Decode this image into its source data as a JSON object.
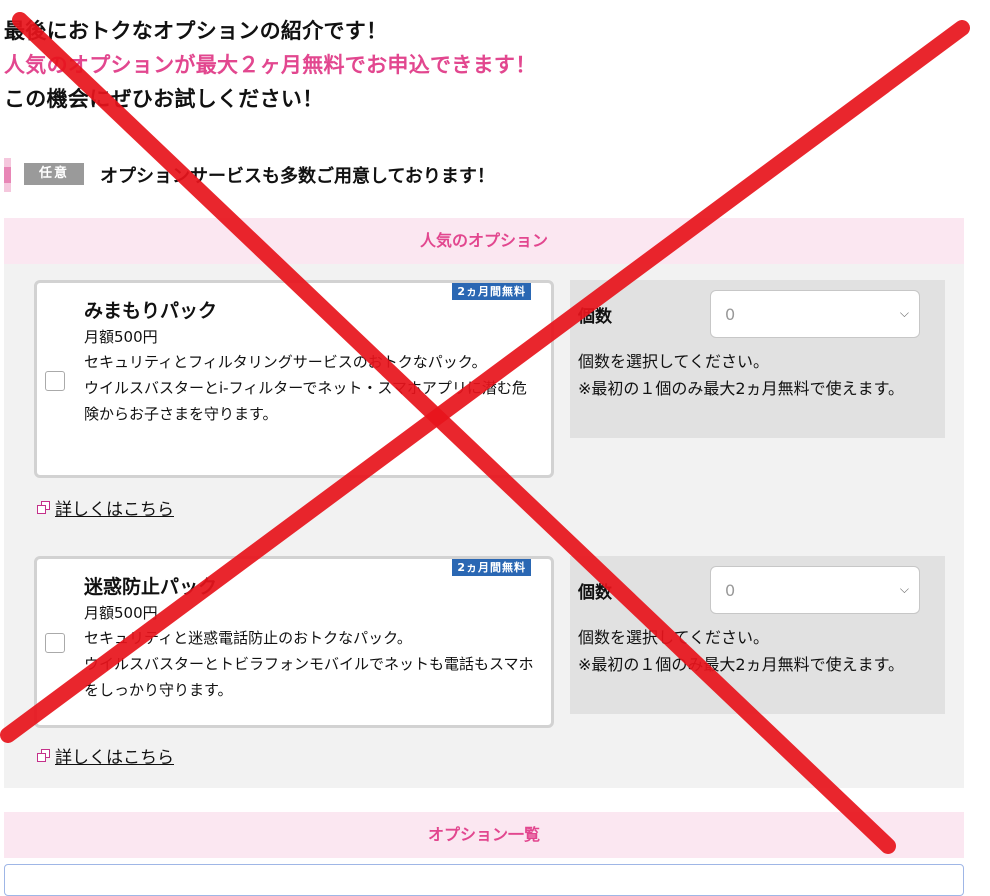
{
  "intro": {
    "line1": "最後におトクなオプションの紹介です！",
    "line2": "人気のオプションが最大２ヶ月無料でお申込できます！",
    "line3": "この機会にぜひお試しください！"
  },
  "section": {
    "badge": "任意",
    "title": "オプションサービスも多数ご用意しております！"
  },
  "popular": {
    "heading": "人気のオプション",
    "options": [
      {
        "free_badge": "2ヵ月間無料",
        "name": "みまもりパック",
        "price": "月額500円",
        "desc1": "セキュリティとフィルタリングサービスのおトクなパック。",
        "desc2": "ウイルスバスターとi-フィルターでネット・スマホアプリに潜む危険からお子さまを守ります。",
        "qty_label": "個数",
        "qty_value": "0",
        "help": "個数を選択してください。\n※最初の１個のみ最大2ヵ月無料で使えます。",
        "detail_link": "詳しくはこちら"
      },
      {
        "free_badge": "2ヵ月間無料",
        "name": "迷惑防止パック",
        "price": "月額500円",
        "desc1": "セキュリティと迷惑電話防止のおトクなパック。",
        "desc2": "ウイルスバスターとトビラフォンモバイルでネットも電話もスマホをしっかり守ります。",
        "qty_label": "個数",
        "qty_value": "0",
        "help": "個数を選択してください。\n※最初の１個のみ最大2ヵ月無料で使えます。",
        "detail_link": "詳しくはこちら"
      }
    ]
  },
  "list": {
    "heading": "オプション一覧"
  },
  "colors": {
    "accent_pink": "#e2478f",
    "panel_head_bg": "#fbe7f1",
    "free_badge_bg": "#2a67b3",
    "cross_red": "#e8141c"
  },
  "overlay": "red-cross-mark"
}
